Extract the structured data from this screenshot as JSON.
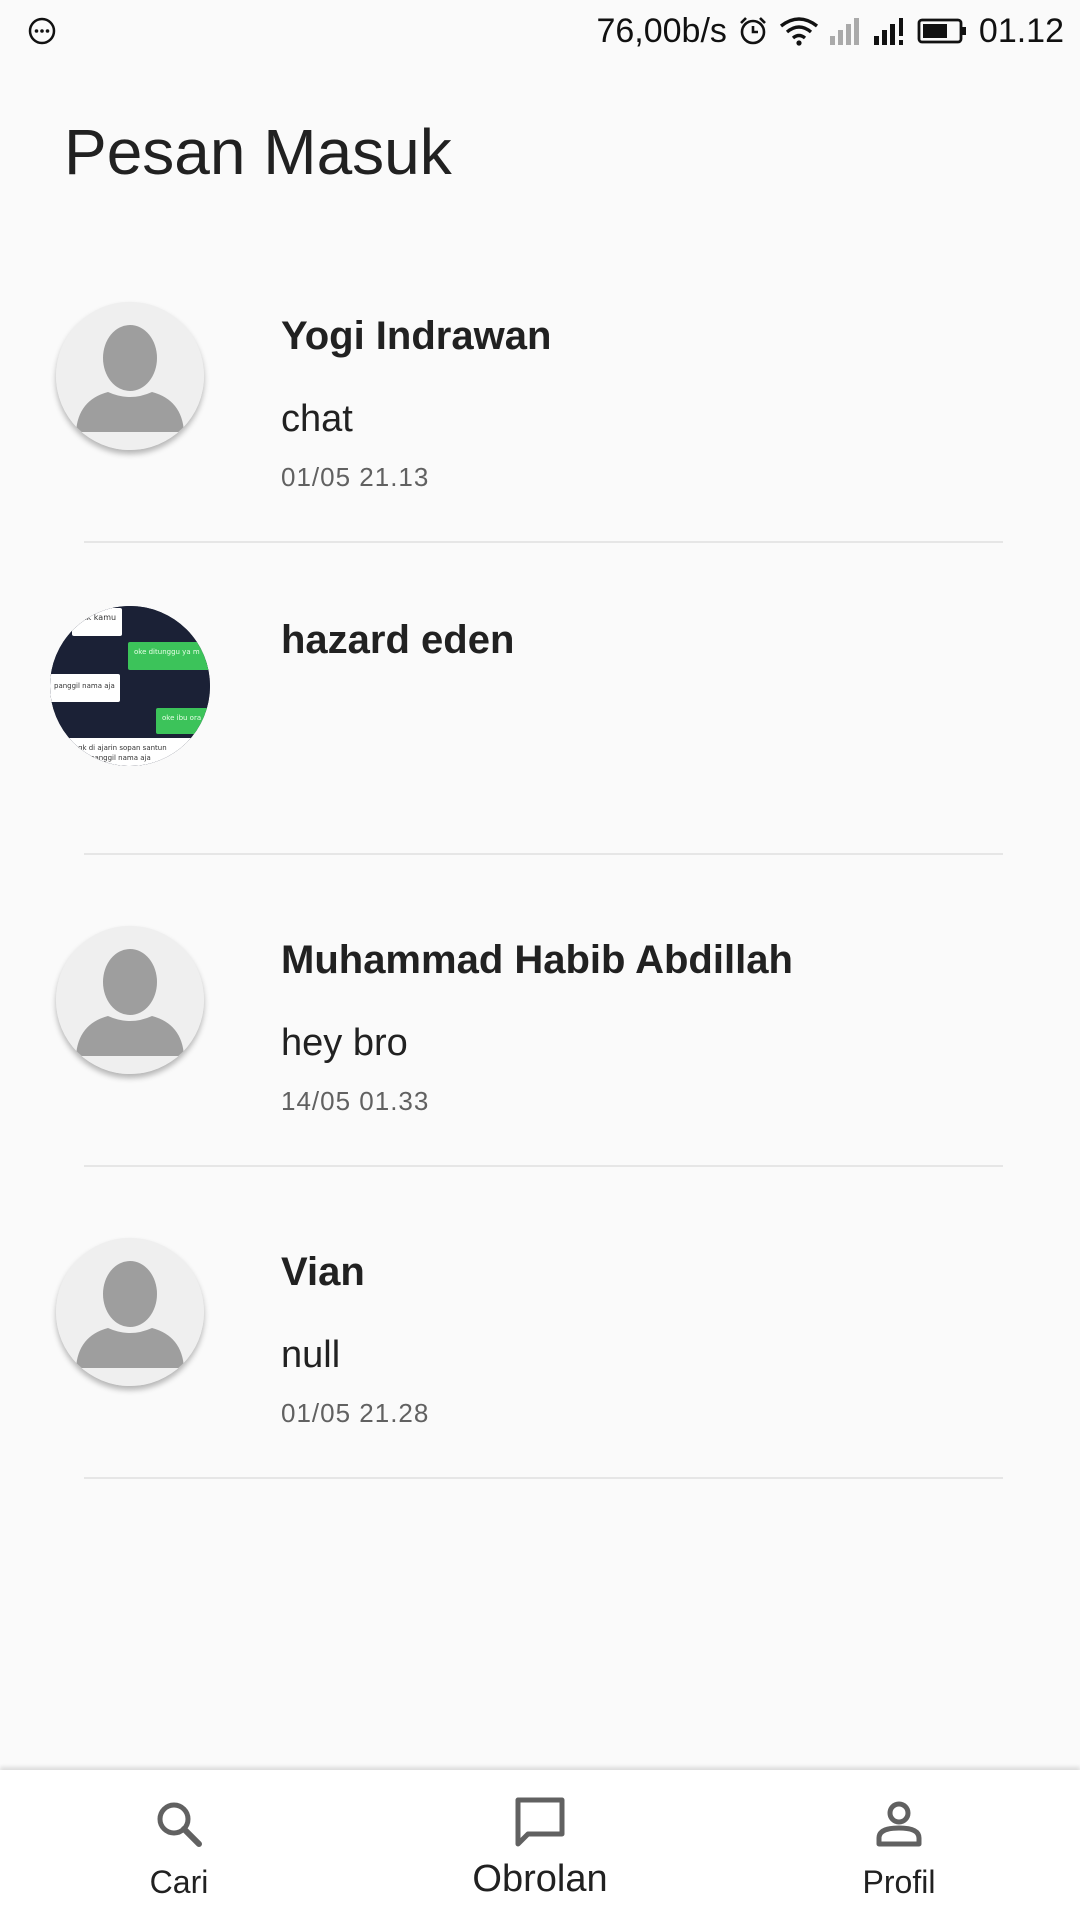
{
  "status_bar": {
    "net_speed": "76,00b/s",
    "time": "01.12",
    "icons": [
      "more-dots-icon",
      "alarm-icon",
      "wifi-icon",
      "signal-weak-icon",
      "signal-icon",
      "battery-icon"
    ]
  },
  "page": {
    "title": "Pesan Masuk"
  },
  "chats": [
    {
      "name": "Yogi Indrawan",
      "message": "chat",
      "time": "01/05 21.13",
      "avatar": "default-avatar-icon"
    },
    {
      "name": "hazard eden",
      "message": "",
      "time": "",
      "avatar": "photo-avatar",
      "avatar_snippets": [
        "kk kamu",
        "oke ditunggu ya m",
        "panggil nama aja",
        "oke ibu ora",
        "gk di ajarin sopan santun",
        "panggil nama aja"
      ]
    },
    {
      "name": "Muhammad Habib Abdillah",
      "message": "hey bro",
      "time": "14/05 01.33",
      "avatar": "default-avatar-icon"
    },
    {
      "name": "Vian",
      "message": "null",
      "time": "01/05 21.28",
      "avatar": "default-avatar-icon"
    }
  ],
  "bottom_nav": {
    "items": [
      {
        "label": "Cari",
        "icon": "search-icon",
        "active": false
      },
      {
        "label": "Obrolan",
        "icon": "chat-bubble-icon",
        "active": true
      },
      {
        "label": "Profil",
        "icon": "person-icon",
        "active": false
      }
    ]
  },
  "colors": {
    "background": "#fafafa",
    "text_primary": "#212121",
    "text_secondary": "#616161",
    "avatar_placeholder": "#9e9e9e",
    "photo_bg": "#1b2136",
    "photo_green": "#3cc35a"
  }
}
